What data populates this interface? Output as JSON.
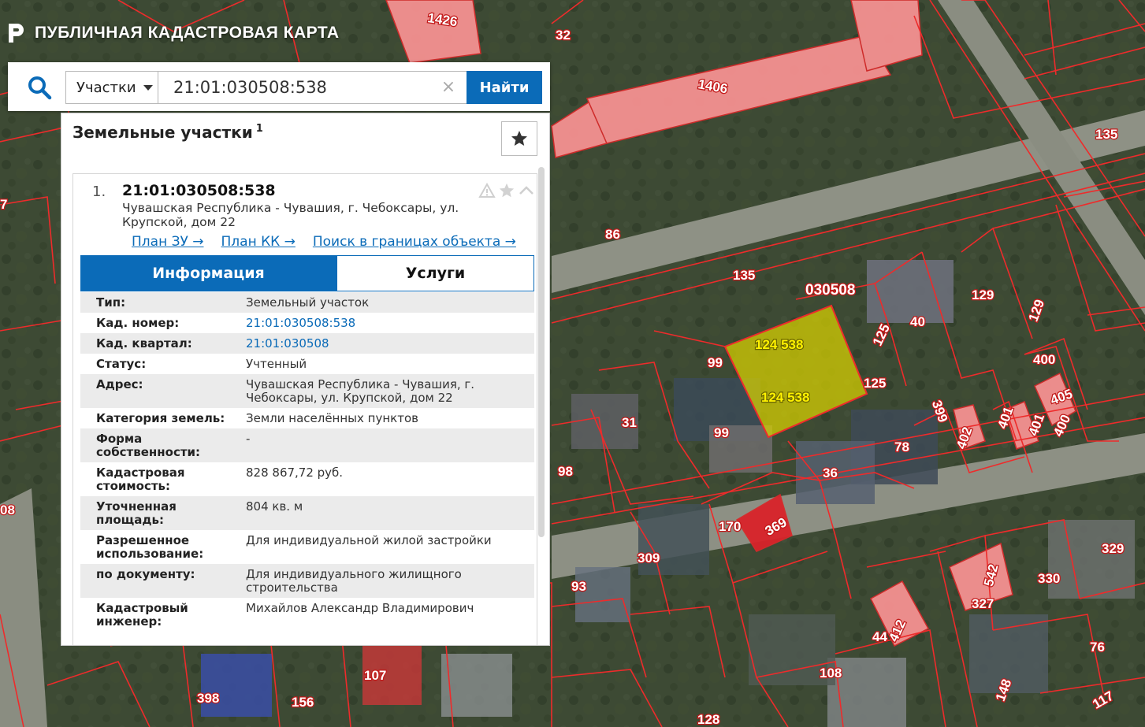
{
  "app": {
    "title": "ПУБЛИЧНАЯ КАДАСТРОВАЯ КАРТА"
  },
  "search": {
    "type_label": "Участки",
    "query": "21:01:030508:538",
    "clear_label": "×",
    "button_label": "Найти"
  },
  "results": {
    "title": "Земельные участки",
    "count": "1",
    "item": {
      "index": "1.",
      "cad_number": "21:01:030508:538",
      "address": "Чувашская Республика - Чувашия, г. Чебоксары, ул. Крупской, дом 22",
      "links": [
        {
          "label": "План ЗУ →"
        },
        {
          "label": "План КК →"
        },
        {
          "label": "Поиск в границах объекта →"
        }
      ],
      "tabs": [
        {
          "label": "Информация",
          "active": true
        },
        {
          "label": "Услуги",
          "active": false
        }
      ],
      "info_rows": [
        {
          "key": "Тип:",
          "value": "Земельный участок"
        },
        {
          "key": "Кад. номер:",
          "value": "21:01:030508:538"
        },
        {
          "key": "Кад. квартал:",
          "value": "21:01:030508"
        },
        {
          "key": "Статус:",
          "value": "Учтенный"
        },
        {
          "key": "Адрес:",
          "value": "Чувашская Республика - Чувашия, г. Чебоксары, ул. Крупской, дом 22"
        },
        {
          "key": "Категория земель:",
          "value": "Земли населённых пунктов"
        },
        {
          "key": "Форма собственности:",
          "value": "-"
        },
        {
          "key": "Кадастровая стоимость:",
          "value": "828 867,72 руб."
        },
        {
          "key": "Уточненная площадь:",
          "value": "804 кв. м"
        },
        {
          "key": "Разрешенное использование:",
          "value": "Для индивидуальной жилой застройки"
        },
        {
          "key": "по документу:",
          "value": "Для индивидуального жилищного строительства"
        },
        {
          "key": "Кадастровый инженер:",
          "value": "Михайлов Александр Владимирович"
        }
      ]
    }
  },
  "map": {
    "labels": {
      "l1426": "1426",
      "l32": "32",
      "l1406": "1406",
      "l135a": "135",
      "l135b": "135",
      "l7": "7",
      "l86": "86",
      "l030508": "030508",
      "l129a": "129",
      "l129b": "129",
      "l40": "40",
      "l125a": "125",
      "l125b": "125",
      "l99a": "99",
      "l99b": "99",
      "l124a": "124 538",
      "l124b": "124 538",
      "l31": "31",
      "l400a": "400",
      "l405": "405",
      "l400b": "400",
      "l401a": "401",
      "l401b": "401",
      "l399": "399",
      "l402": "402",
      "l78": "78",
      "l98": "98",
      "l36": "36",
      "l08": "08",
      "l170": "170",
      "l369": "369",
      "l309": "309",
      "l329": "329",
      "l542": "542",
      "l330": "330",
      "l327": "327",
      "l93": "93",
      "l44": "44",
      "l412": "412",
      "l76": "76",
      "l107": "107",
      "l108": "108",
      "l148": "148",
      "l398": "398",
      "l156": "156",
      "l117": "117",
      "l128": "128"
    }
  }
}
